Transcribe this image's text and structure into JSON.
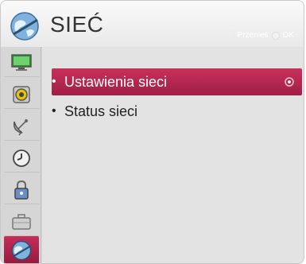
{
  "header": {
    "title": "SIEĆ",
    "hint_move": "Przenieś",
    "hint_ok": "OK"
  },
  "sidebar": {
    "items": [
      {
        "icon": "monitor-icon"
      },
      {
        "icon": "speaker-icon"
      },
      {
        "icon": "satellite-dish-icon"
      },
      {
        "icon": "clock-icon"
      },
      {
        "icon": "lock-icon"
      },
      {
        "icon": "briefcase-icon"
      },
      {
        "icon": "network-globe-icon",
        "active": true
      }
    ]
  },
  "menu": {
    "items": [
      {
        "label": "Ustawienia sieci",
        "selected": true
      },
      {
        "label": "Status sieci",
        "selected": false
      }
    ]
  },
  "colors": {
    "accent": "#b8264e",
    "background": "#e3e3e3"
  }
}
